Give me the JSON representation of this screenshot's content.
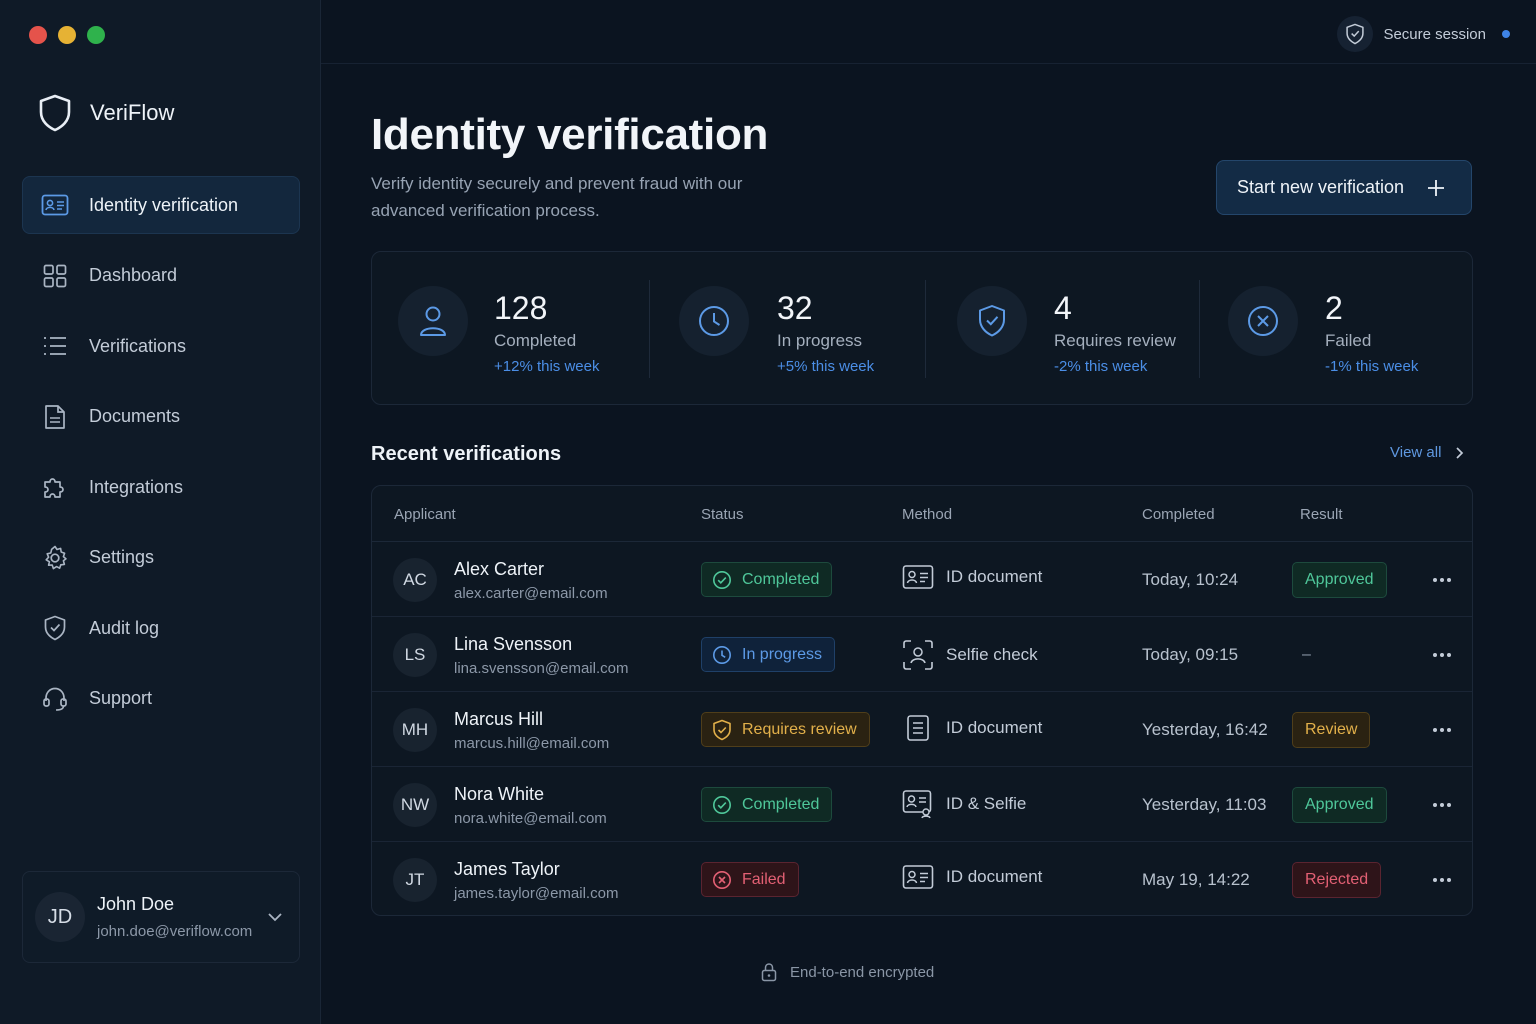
{
  "app": {
    "name": "VeriFlow"
  },
  "window_controls": {
    "colors": [
      "#e5534b",
      "#e6b234",
      "#2fb24c"
    ]
  },
  "sidebar": {
    "items": [
      {
        "label": "Identity verification",
        "icon": "id-card-icon",
        "active": true
      },
      {
        "label": "Dashboard",
        "icon": "grid-icon"
      },
      {
        "label": "Verifications",
        "icon": "list-icon"
      },
      {
        "label": "Documents",
        "icon": "document-icon"
      },
      {
        "label": "Integrations",
        "icon": "puzzle-icon"
      },
      {
        "label": "Settings",
        "icon": "gear-icon"
      },
      {
        "label": "Audit log",
        "icon": "shield-check-icon"
      },
      {
        "label": "Support",
        "icon": "headset-icon"
      }
    ],
    "user": {
      "initials": "JD",
      "name": "John Doe",
      "email": "john.doe@veriflow.com"
    }
  },
  "topbar": {
    "secure_label": "Secure session"
  },
  "header": {
    "title": "Identity verification",
    "subtitle": "Verify identity securely and prevent fraud with our advanced verification process.",
    "primary_button": "Start new verification"
  },
  "stats": [
    {
      "value": "128",
      "label": "Completed",
      "trend": "+12% this week",
      "icon": "user-icon"
    },
    {
      "value": "32",
      "label": "In progress",
      "trend": "+5% this week",
      "icon": "clock-icon"
    },
    {
      "value": "4",
      "label": "Requires review",
      "trend": "-2% this week",
      "icon": "shield-check-icon"
    },
    {
      "value": "2",
      "label": "Failed",
      "trend": "-1% this week",
      "icon": "x-circle-icon"
    }
  ],
  "recent": {
    "title": "Recent verifications",
    "view_all": "View all",
    "columns": [
      "Applicant",
      "Status",
      "Method",
      "Completed",
      "Result"
    ],
    "rows": [
      {
        "initials": "AC",
        "name": "Alex Carter",
        "email": "alex.carter@email.com",
        "status": "Completed",
        "method": "ID document",
        "completed": "Today, 10:24",
        "result": "Approved"
      },
      {
        "initials": "LS",
        "name": "Lina Svensson",
        "email": "lina.svensson@email.com",
        "status": "In progress",
        "method": "Selfie check",
        "completed": "Today, 09:15",
        "result": "–"
      },
      {
        "initials": "MH",
        "name": "Marcus Hill",
        "email": "marcus.hill@email.com",
        "status": "Requires review",
        "method": "ID document",
        "completed": "Yesterday, 16:42",
        "result": "Review"
      },
      {
        "initials": "NW",
        "name": "Nora White",
        "email": "nora.white@email.com",
        "status": "Completed",
        "method": "ID & Selfie",
        "completed": "Yesterday, 11:03",
        "result": "Approved"
      },
      {
        "initials": "JT",
        "name": "James Taylor",
        "email": "james.taylor@email.com",
        "status": "Failed",
        "method": "ID document",
        "completed": "May 19, 14:22",
        "result": "Rejected"
      }
    ]
  },
  "footer": {
    "text": "End-to-end encrypted"
  }
}
